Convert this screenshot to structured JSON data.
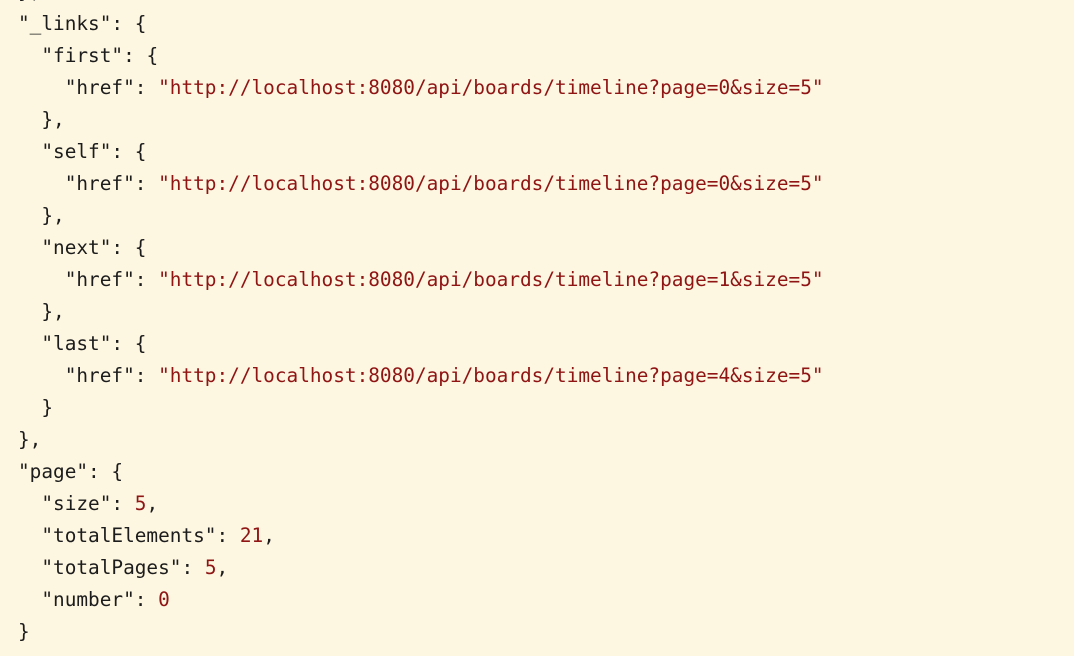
{
  "colors": {
    "background": "#fdf6e0",
    "punctuation": "#1c1c1c",
    "key": "#1c1c1c",
    "string": "#8f1414",
    "number": "#8f1414"
  },
  "json_view": {
    "lines": [
      {
        "indent": 0,
        "tokens": [
          {
            "t": "p",
            "v": "},"
          }
        ]
      },
      {
        "indent": 0,
        "tokens": [
          {
            "t": "k",
            "v": "\"_links\""
          },
          {
            "t": "p",
            "v": ": {"
          }
        ]
      },
      {
        "indent": 1,
        "tokens": [
          {
            "t": "k",
            "v": "\"first\""
          },
          {
            "t": "p",
            "v": ": {"
          }
        ]
      },
      {
        "indent": 2,
        "tokens": [
          {
            "t": "k",
            "v": "\"href\""
          },
          {
            "t": "p",
            "v": ": "
          },
          {
            "t": "s",
            "v": "\"http://localhost:8080/api/boards/timeline?page=0&size=5\""
          }
        ]
      },
      {
        "indent": 1,
        "tokens": [
          {
            "t": "p",
            "v": "},"
          }
        ]
      },
      {
        "indent": 1,
        "tokens": [
          {
            "t": "k",
            "v": "\"self\""
          },
          {
            "t": "p",
            "v": ": {"
          }
        ]
      },
      {
        "indent": 2,
        "tokens": [
          {
            "t": "k",
            "v": "\"href\""
          },
          {
            "t": "p",
            "v": ": "
          },
          {
            "t": "s",
            "v": "\"http://localhost:8080/api/boards/timeline?page=0&size=5\""
          }
        ]
      },
      {
        "indent": 1,
        "tokens": [
          {
            "t": "p",
            "v": "},"
          }
        ]
      },
      {
        "indent": 1,
        "tokens": [
          {
            "t": "k",
            "v": "\"next\""
          },
          {
            "t": "p",
            "v": ": {"
          }
        ]
      },
      {
        "indent": 2,
        "tokens": [
          {
            "t": "k",
            "v": "\"href\""
          },
          {
            "t": "p",
            "v": ": "
          },
          {
            "t": "s",
            "v": "\"http://localhost:8080/api/boards/timeline?page=1&size=5\""
          }
        ]
      },
      {
        "indent": 1,
        "tokens": [
          {
            "t": "p",
            "v": "},"
          }
        ]
      },
      {
        "indent": 1,
        "tokens": [
          {
            "t": "k",
            "v": "\"last\""
          },
          {
            "t": "p",
            "v": ": {"
          }
        ]
      },
      {
        "indent": 2,
        "tokens": [
          {
            "t": "k",
            "v": "\"href\""
          },
          {
            "t": "p",
            "v": ": "
          },
          {
            "t": "s",
            "v": "\"http://localhost:8080/api/boards/timeline?page=4&size=5\""
          }
        ]
      },
      {
        "indent": 1,
        "tokens": [
          {
            "t": "p",
            "v": "}"
          }
        ]
      },
      {
        "indent": 0,
        "tokens": [
          {
            "t": "p",
            "v": "},"
          }
        ]
      },
      {
        "indent": 0,
        "tokens": [
          {
            "t": "k",
            "v": "\"page\""
          },
          {
            "t": "p",
            "v": ": {"
          }
        ]
      },
      {
        "indent": 1,
        "tokens": [
          {
            "t": "k",
            "v": "\"size\""
          },
          {
            "t": "p",
            "v": ": "
          },
          {
            "t": "n",
            "v": "5"
          },
          {
            "t": "p",
            "v": ","
          }
        ]
      },
      {
        "indent": 1,
        "tokens": [
          {
            "t": "k",
            "v": "\"totalElements\""
          },
          {
            "t": "p",
            "v": ": "
          },
          {
            "t": "n",
            "v": "21"
          },
          {
            "t": "p",
            "v": ","
          }
        ]
      },
      {
        "indent": 1,
        "tokens": [
          {
            "t": "k",
            "v": "\"totalPages\""
          },
          {
            "t": "p",
            "v": ": "
          },
          {
            "t": "n",
            "v": "5"
          },
          {
            "t": "p",
            "v": ","
          }
        ]
      },
      {
        "indent": 1,
        "tokens": [
          {
            "t": "k",
            "v": "\"number\""
          },
          {
            "t": "p",
            "v": ": "
          },
          {
            "t": "n",
            "v": "0"
          }
        ]
      },
      {
        "indent": 0,
        "tokens": [
          {
            "t": "p",
            "v": "}"
          }
        ]
      }
    ]
  }
}
